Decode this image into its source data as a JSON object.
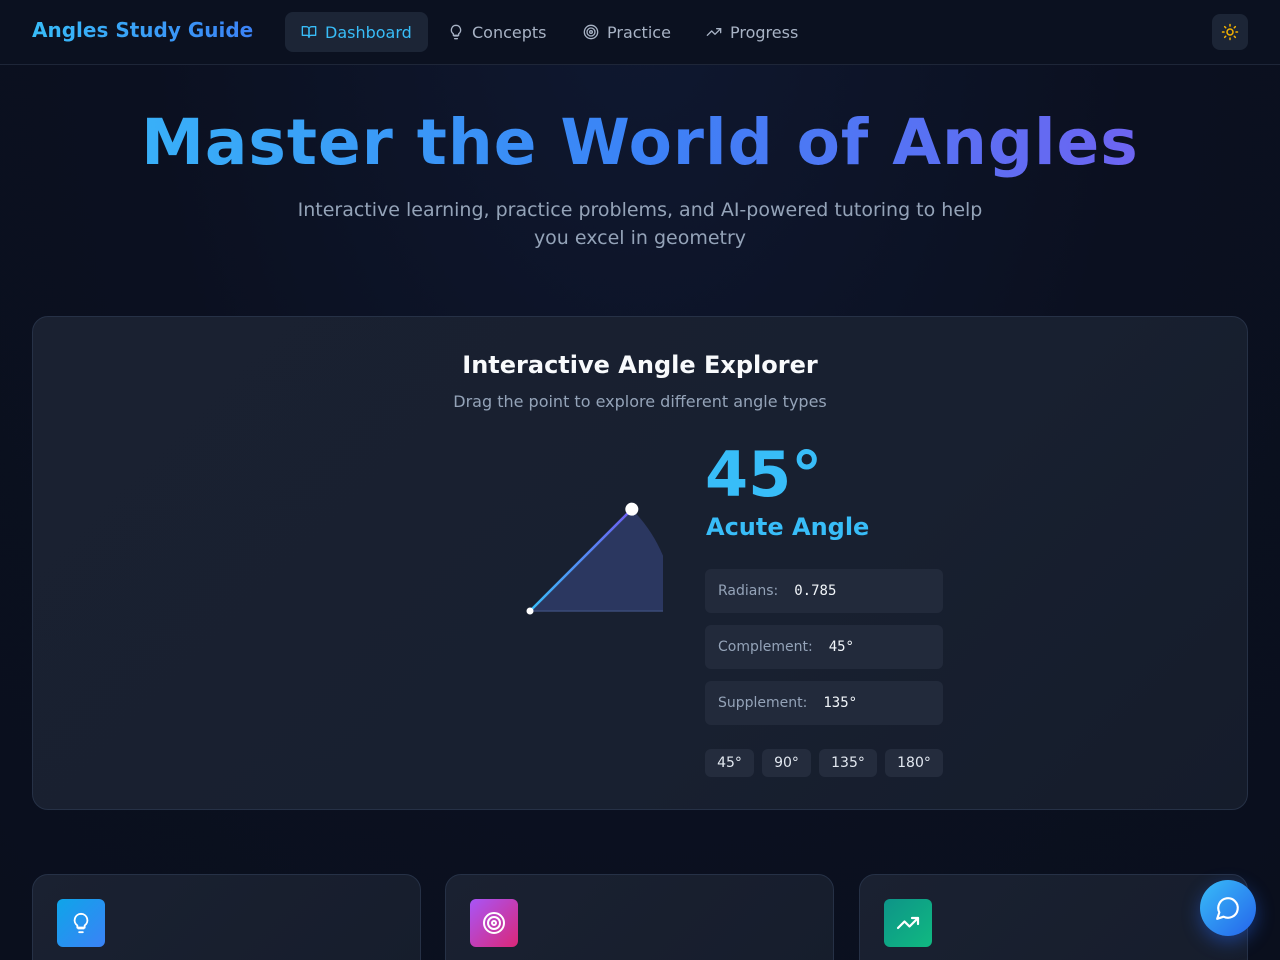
{
  "app": {
    "title": "Angles Study Guide"
  },
  "nav": {
    "items": [
      {
        "label": "Dashboard",
        "icon": "book-open-icon",
        "active": true
      },
      {
        "label": "Concepts",
        "icon": "lightbulb-icon",
        "active": false
      },
      {
        "label": "Practice",
        "icon": "target-icon",
        "active": false
      },
      {
        "label": "Progress",
        "icon": "trending-up-icon",
        "active": false
      }
    ],
    "theme_toggle_icon": "sun-icon"
  },
  "hero": {
    "title": "Master the World of Angles",
    "subtitle": "Interactive learning, practice problems, and AI-powered tutoring to help you excel in geometry"
  },
  "explorer": {
    "title": "Interactive Angle Explorer",
    "subtitle": "Drag the point to explore different angle types",
    "angle_display": "45°",
    "angle_degrees": 45,
    "angle_type": "Acute Angle",
    "stats": [
      {
        "label": "Radians:",
        "value": "0.785"
      },
      {
        "label": "Complement:",
        "value": "45°"
      },
      {
        "label": "Supplement:",
        "value": "135°"
      }
    ],
    "presets": [
      "45°",
      "90°",
      "135°",
      "180°"
    ]
  },
  "features": [
    {
      "icon": "lightbulb-icon",
      "color": "#3b82f6"
    },
    {
      "icon": "target-icon",
      "color": "#c026d3"
    },
    {
      "icon": "trending-up-icon",
      "color": "#0f9f7a"
    }
  ],
  "chat_button_icon": "chat-bubble-icon",
  "colors": {
    "accent": "#38bdf8",
    "accent_purple": "#7c5cf0",
    "sun": "#f5b301"
  }
}
